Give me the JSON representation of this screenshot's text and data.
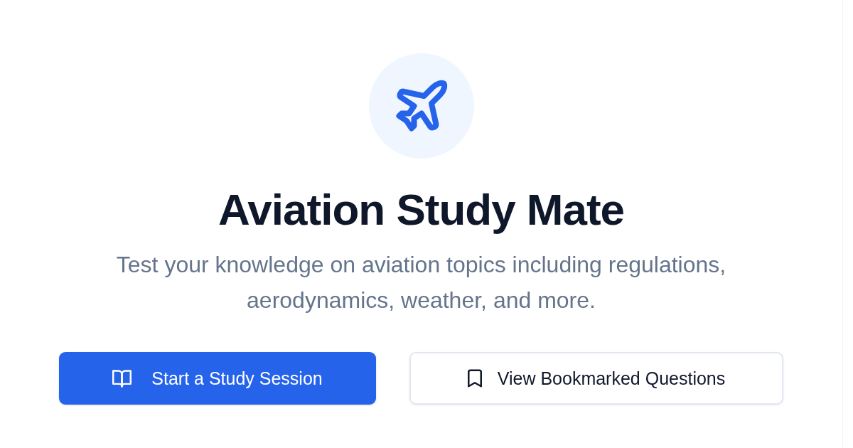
{
  "hero": {
    "title": "Aviation Study Mate",
    "subtitle": "Test your knowledge on aviation topics including regulations, aerodynamics, weather, and more."
  },
  "actions": [
    {
      "label": "Start a Study Session",
      "kind": "primary"
    },
    {
      "label": "View Bookmarked Questions",
      "kind": "secondary"
    }
  ]
}
